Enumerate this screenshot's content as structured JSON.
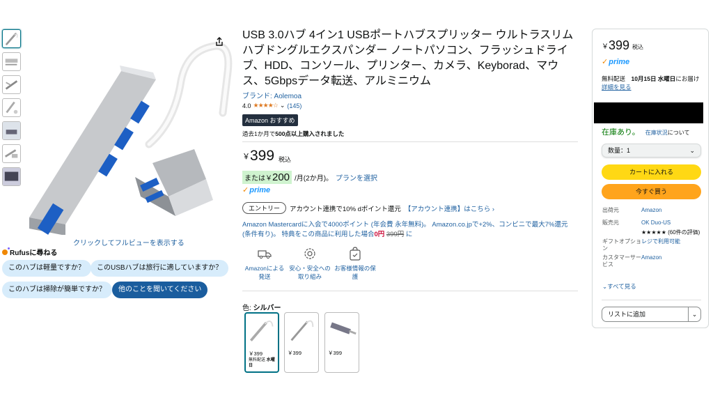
{
  "gallery": {
    "thumb_count": 7,
    "full_view_label": "クリックしてフルビューを表示する"
  },
  "rufus": {
    "title": "Rufusに尋ねる",
    "chips": [
      "このハブは軽量ですか？",
      "このUSBハブは旅行に適していますか？",
      "このハブは掃除が簡単ですか？",
      "他のことを聞いてください"
    ]
  },
  "product": {
    "title": "USB 3.0ハブ 4イン1 USBポートハブスプリッター ウルトラスリム ハブドングルエクスパンダー ノートパソコン、フラッシュドライブ、HDD、コンソール、プリンター、カメラ、Keyborad、マウス、5Gbpsデータ転送、アルミニウム",
    "brand": "ブランド: Aolemoa",
    "rating_value": "4.0",
    "stars": "★★★★☆",
    "review_count": "(145)",
    "badge": "Amazon おすすめ",
    "bought_prefix": "過去1か月で",
    "bought_bold": "500点以上購入されました",
    "price_currency": "￥",
    "price_value": "399",
    "price_tax": "税込",
    "installment_prefix": "または",
    "installment_cur": "￥",
    "installment_value": "200",
    "installment_suffix": "/月(2か月)。",
    "installment_link": "プランを選択",
    "prime_label": "prime",
    "entry_label": "エントリー",
    "dpoint_text": "アカウント連携で10% dポイント還元",
    "dpoint_link": "【アカウント連携】はこちら ›",
    "mc_text": "Amazon Mastercardに入会で4000ポイント (年会費 永年無料)。 Amazon.co.jpで+2%、コンビニで最大7%還元(条件有り)。 特典をこの商品に利用した場合",
    "mc_price": "0円",
    "mc_strike": "399円",
    "mc_tail": " に",
    "features": [
      {
        "icon": "truck-icon",
        "label": "Amazonによる発送"
      },
      {
        "icon": "shield-gear-icon",
        "label": "安心・安全への取り組み"
      },
      {
        "icon": "shopping-bag-check-icon",
        "label": "お客様情報の保護"
      }
    ],
    "color_label": "色: ",
    "color_value": "シルバー",
    "variants": [
      {
        "price": "￥399",
        "ship": "無料配送",
        "ship_bold": "水曜日"
      },
      {
        "price": "￥399"
      },
      {
        "price": "￥399"
      }
    ]
  },
  "buybox": {
    "price_currency": "￥",
    "price_value": "399",
    "price_tax": "税込",
    "prime_label": "prime",
    "delivery_prefix": "無料配送",
    "delivery_date": "10月15日 水曜日",
    "delivery_suffix": "にお届け",
    "delivery_link": "詳細を見る",
    "stock": "在庫あり。",
    "stock_link": "在庫状況",
    "stock_suffix": "について",
    "qty_label": "数量：1",
    "cart_button": "カートに入れる",
    "buy_button": "今すぐ買う",
    "rows": [
      {
        "key": "出荷元",
        "value": "Amazon"
      },
      {
        "key": "販売元",
        "value": "OK Duo-US"
      },
      {
        "key": "",
        "value": "★★★★★ (60件の評価)"
      },
      {
        "key": "ギフトオプション",
        "value": "レジで利用可能"
      },
      {
        "key": "カスタマーサービス",
        "value": "Amazon"
      }
    ],
    "see_more": "すべて見る",
    "wishlist": "リストに追加"
  }
}
